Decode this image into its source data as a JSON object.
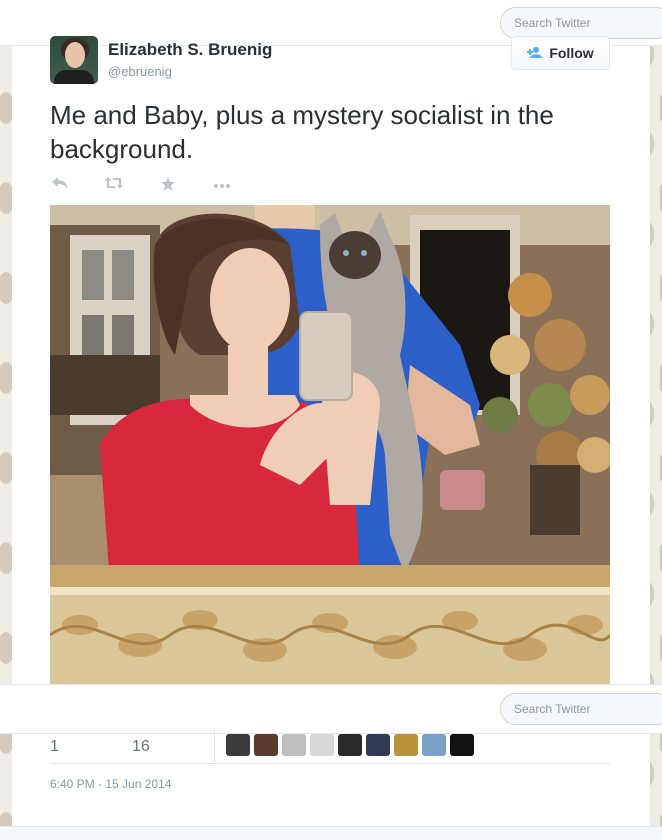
{
  "search": {
    "placeholder": "Search Twitter"
  },
  "tweet": {
    "author_name": "Elizabeth S. Bruenig",
    "author_handle": "@ebruenig",
    "follow_label": "Follow",
    "text": "Me and Baby, plus a mystery socialist in the background.",
    "actions": [
      "reply-icon",
      "retweet-icon",
      "favorite-icon",
      "more-icon"
    ],
    "retweets": "1",
    "favorites": "16",
    "timestamp": "6:40 PM - 15 Jun 2014",
    "favoriter_avatar_colors": [
      "#3b3b3b",
      "#5a3b2e",
      "#bfbfbf",
      "#d8d8d8",
      "#2a2a2a",
      "#333a55",
      "#b8913b",
      "#7aa0c8",
      "#111111"
    ]
  },
  "colors": {
    "accent": "#55acee",
    "text": "#292f33",
    "muted": "#8899a6"
  }
}
